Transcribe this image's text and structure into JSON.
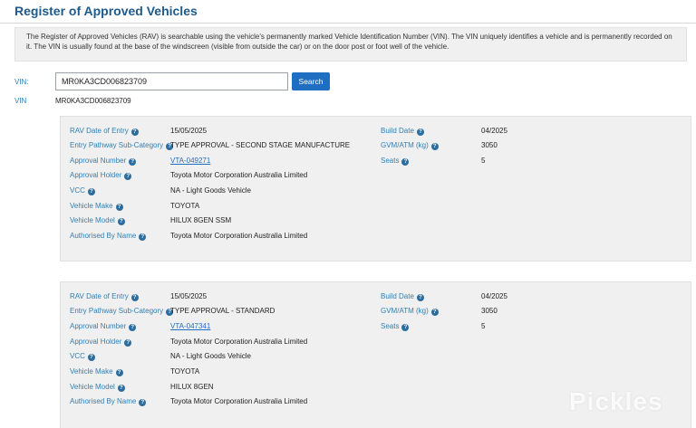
{
  "page": {
    "title": "Register of Approved Vehicles",
    "intro": "The Register of Approved Vehicles (RAV) is searchable using the vehicle's permanently marked Vehicle Identification Number (VIN). The VIN uniquely identifies a vehicle and is permanently recorded on it. The VIN is usually found at the base of the windscreen (visible from outside the car) or on the door post or foot well of the vehicle."
  },
  "search": {
    "label": "VIN:",
    "value": "MR0KA3CD006823709",
    "button": "Search"
  },
  "result": {
    "label": "VIN",
    "value": "MR0KA3CD006823709"
  },
  "labels": {
    "rav_date": "RAV Date of Entry",
    "pathway": "Entry Pathway Sub-Category",
    "approval_number": "Approval Number",
    "approval_holder": "Approval Holder",
    "vcc": "VCC",
    "make": "Vehicle Make",
    "model": "Vehicle Model",
    "authorised_by": "Authorised By Name",
    "build_date": "Build Date",
    "gvm": "GVM/ATM (kg)",
    "seats": "Seats"
  },
  "records": [
    {
      "rav_date": "15/05/2025",
      "pathway": "TYPE APPROVAL - SECOND STAGE MANUFACTURE",
      "approval_number": "VTA-049271",
      "approval_holder": "Toyota Motor Corporation Australia Limited",
      "vcc": "NA - Light Goods Vehicle",
      "make": "TOYOTA",
      "model": "HILUX 8GEN SSM",
      "authorised_by": "Toyota Motor Corporation Australia Limited",
      "build_date": "04/2025",
      "gvm": "3050",
      "seats": "5"
    },
    {
      "rav_date": "15/05/2025",
      "pathway": "TYPE APPROVAL - STANDARD",
      "approval_number": "VTA-047341",
      "approval_holder": "Toyota Motor Corporation Australia Limited",
      "vcc": "NA - Light Goods Vehicle",
      "make": "TOYOTA",
      "model": "HILUX 8GEN",
      "authorised_by": "Toyota Motor Corporation Australia Limited",
      "build_date": "04/2025",
      "gvm": "3050",
      "seats": "5"
    }
  ],
  "watermark": "Pickles",
  "icons": {
    "help": "question-circle-icon"
  },
  "colors": {
    "title": "#1f5a8c",
    "label": "#2f7fb5",
    "button": "#1f6ec2"
  }
}
